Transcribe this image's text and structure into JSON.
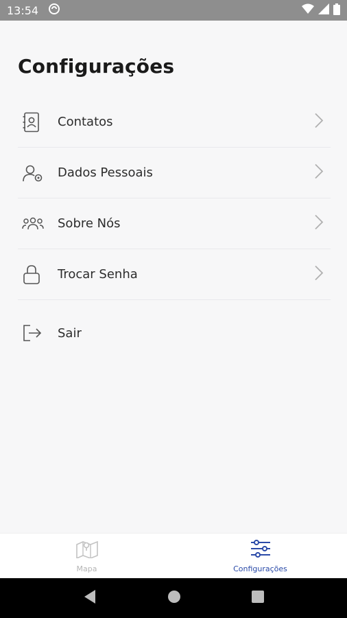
{
  "status_bar": {
    "time": "13:54",
    "icons": [
      "sync-icon",
      "wifi-icon",
      "signal-icon",
      "battery-icon"
    ]
  },
  "page": {
    "title": "Configurações"
  },
  "menu": {
    "items": [
      {
        "label": "Contatos",
        "icon": "contacts-book-icon",
        "has_chevron": true
      },
      {
        "label": "Dados Pessoais",
        "icon": "user-settings-icon",
        "has_chevron": true
      },
      {
        "label": "Sobre Nós",
        "icon": "group-icon",
        "has_chevron": true
      },
      {
        "label": "Trocar Senha",
        "icon": "lock-icon",
        "has_chevron": true
      },
      {
        "label": "Sair",
        "icon": "logout-icon",
        "has_chevron": false
      }
    ]
  },
  "bottom_nav": {
    "tabs": [
      {
        "label": "Mapa",
        "icon": "map-icon",
        "active": false
      },
      {
        "label": "Configurações",
        "icon": "sliders-icon",
        "active": true
      }
    ]
  },
  "colors": {
    "status_bar": "#8e8e8e",
    "background": "#f7f7f8",
    "accent": "#2a4aa8",
    "inactive": "#b5b5b5"
  }
}
